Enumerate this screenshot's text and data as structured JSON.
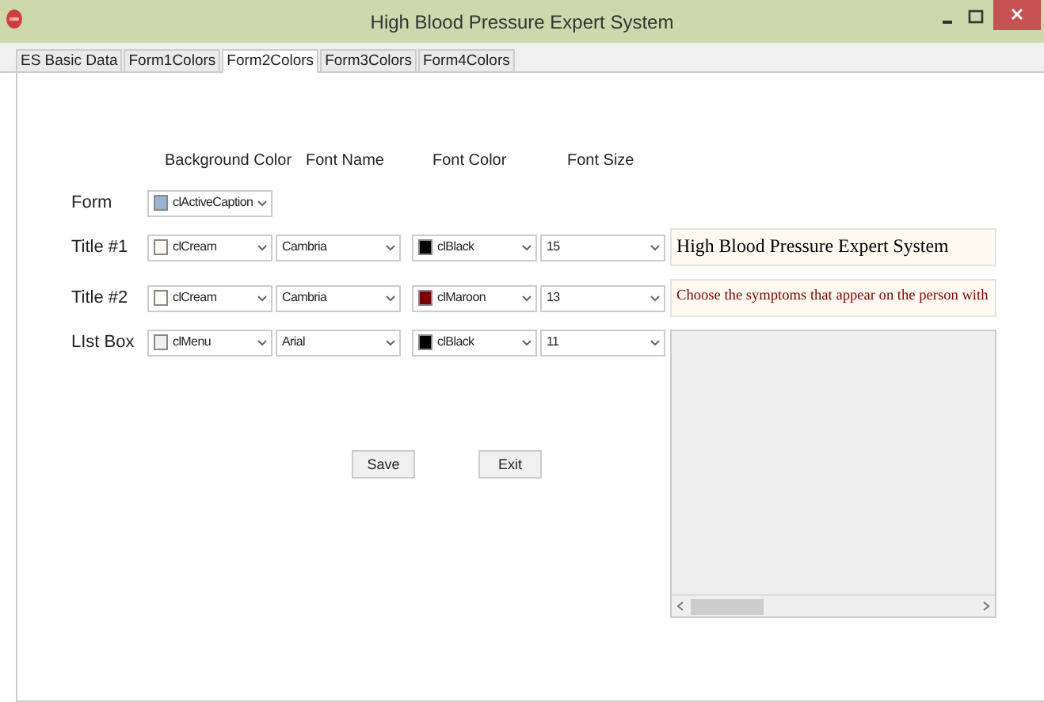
{
  "window": {
    "title": "High Blood Pressure Expert System"
  },
  "tabs": [
    {
      "label": "ES Basic Data",
      "selected": false
    },
    {
      "label": "Form1Colors",
      "selected": false
    },
    {
      "label": "Form2Colors",
      "selected": true
    },
    {
      "label": "Form3Colors",
      "selected": false
    },
    {
      "label": "Form4Colors",
      "selected": false
    }
  ],
  "column_headers": [
    "Background Color",
    "Font Name",
    "Font Color",
    "Font Size"
  ],
  "rows": [
    {
      "label": "Form",
      "background": {
        "value": "clActiveCaption",
        "color": "#99b4d1"
      }
    },
    {
      "label": "Title #1",
      "background": {
        "value": "clCream",
        "color": "#fffbf0"
      },
      "font_name": "Cambria",
      "font_color": {
        "value": "clBlack",
        "color": "#000000"
      },
      "font_size": "15"
    },
    {
      "label": "Title #2",
      "background": {
        "value": "clCream",
        "color": "#fffbf0"
      },
      "font_name": "Cambria",
      "font_color": {
        "value": "clMaroon",
        "color": "#800000"
      },
      "font_size": "13"
    },
    {
      "label": "LIst Box",
      "background": {
        "value": "clMenu",
        "color": "#f0f0f0"
      },
      "font_name": "Arial",
      "font_color": {
        "value": "clBlack",
        "color": "#000000"
      },
      "font_size": "11"
    }
  ],
  "previews": [
    {
      "text": "High Blood Pressure Expert System",
      "color": "#000000"
    },
    {
      "text": "Choose the symptoms that appear on the person with",
      "color": "#800000"
    }
  ],
  "buttons": [
    "Save",
    "Exit"
  ]
}
